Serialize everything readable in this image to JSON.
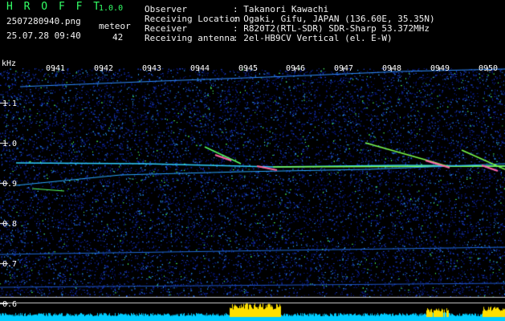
{
  "app": {
    "name": "H R O F F T",
    "version": "1.0.0"
  },
  "file": {
    "name": "2507280940.png",
    "datetime": "25.07.28 09:40"
  },
  "meteor": {
    "label": "meteor",
    "count": "42"
  },
  "info": [
    {
      "key": "Observer",
      "value": ": Takanori Kawachi"
    },
    {
      "key": "Receiving Location",
      "value": ": Ogaki, Gifu, JAPAN (136.60E, 35.35N)"
    },
    {
      "key": "Receiver",
      "value": ": R820T2(RTL-SDR) SDR-Sharp 53.372MHz"
    },
    {
      "key": "Receiving antenna",
      "value": ": 2el-HB9CV Vertical (el. E-W)"
    }
  ],
  "yaxis": {
    "unit": "kHz",
    "ticks": [
      "1.1",
      "1.0",
      "0.9",
      "0.8",
      "0.7",
      "0.6"
    ]
  },
  "xaxis": {
    "ticks": [
      "0941",
      "0942",
      "0943",
      "0944",
      "0945",
      "0946",
      "0947",
      "0948",
      "0949",
      "0950"
    ]
  },
  "colors": {
    "header_green": "#33ff66",
    "signal_green": "#7dff4a",
    "noise_blue": "#1f45d8",
    "level_yellow": "#ffe000",
    "level_cyan": "#00ccff"
  }
}
